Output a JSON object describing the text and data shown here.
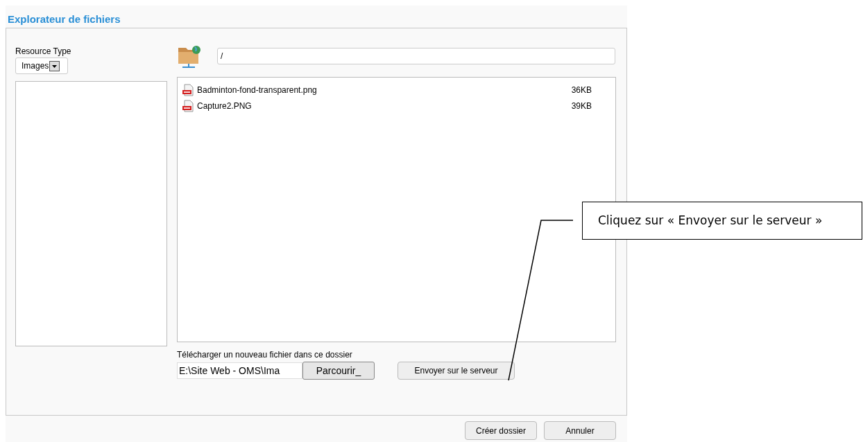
{
  "window": {
    "title": "Explorateur de fichiers"
  },
  "resource_type": {
    "label": "Resource Type",
    "value": "Images"
  },
  "path_field": {
    "value": "/"
  },
  "files": [
    {
      "name": "Badminton-fond-transparent.png",
      "size": "36KB"
    },
    {
      "name": "Capture2.PNG",
      "size": "39KB"
    }
  ],
  "upload": {
    "label": "Télécharger un nouveau fichier dans ce dossier",
    "file_value": "E:\\Site Web - OMS\\Ima",
    "browse_button": "Parcourir_",
    "send_button": "Envoyer sur le serveur"
  },
  "buttons": [
    "Créer dossier",
    "Annuler"
  ],
  "callout": {
    "text": "Cliquez sur « Envoyer sur le serveur »"
  }
}
